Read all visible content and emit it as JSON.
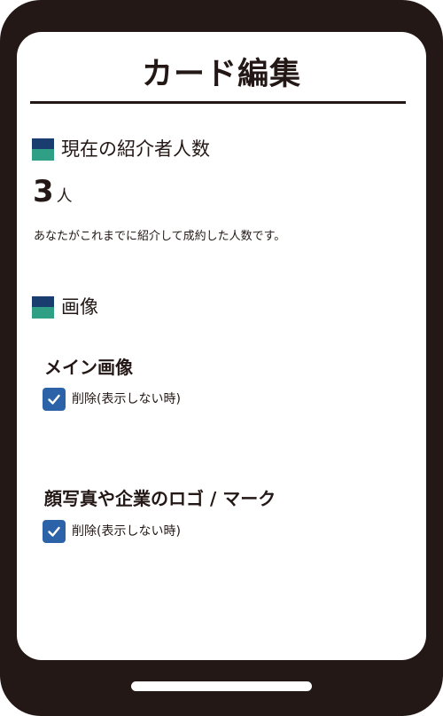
{
  "page": {
    "title": "カード編集"
  },
  "referral": {
    "heading": "現在の紹介者人数",
    "count": "3",
    "unit": "人",
    "description": "あなたがこれまでに紹介して成約した人数です。"
  },
  "images": {
    "heading": "画像",
    "main_image": {
      "label": "メイン画像",
      "delete_option": "削除(表示しない時)",
      "checked": true
    },
    "logo_image": {
      "label": "顔写真や企業のロゴ / マーク",
      "delete_option": "削除(表示しない時)",
      "checked": true
    }
  },
  "colors": {
    "frame": "#231815",
    "checkbox": "#2c63a8",
    "mark_top": "#1a3d70",
    "mark_bottom": "#2f9f86"
  },
  "icons": {
    "checkbox": "checkmark-icon",
    "section": "section-marker-icon"
  }
}
